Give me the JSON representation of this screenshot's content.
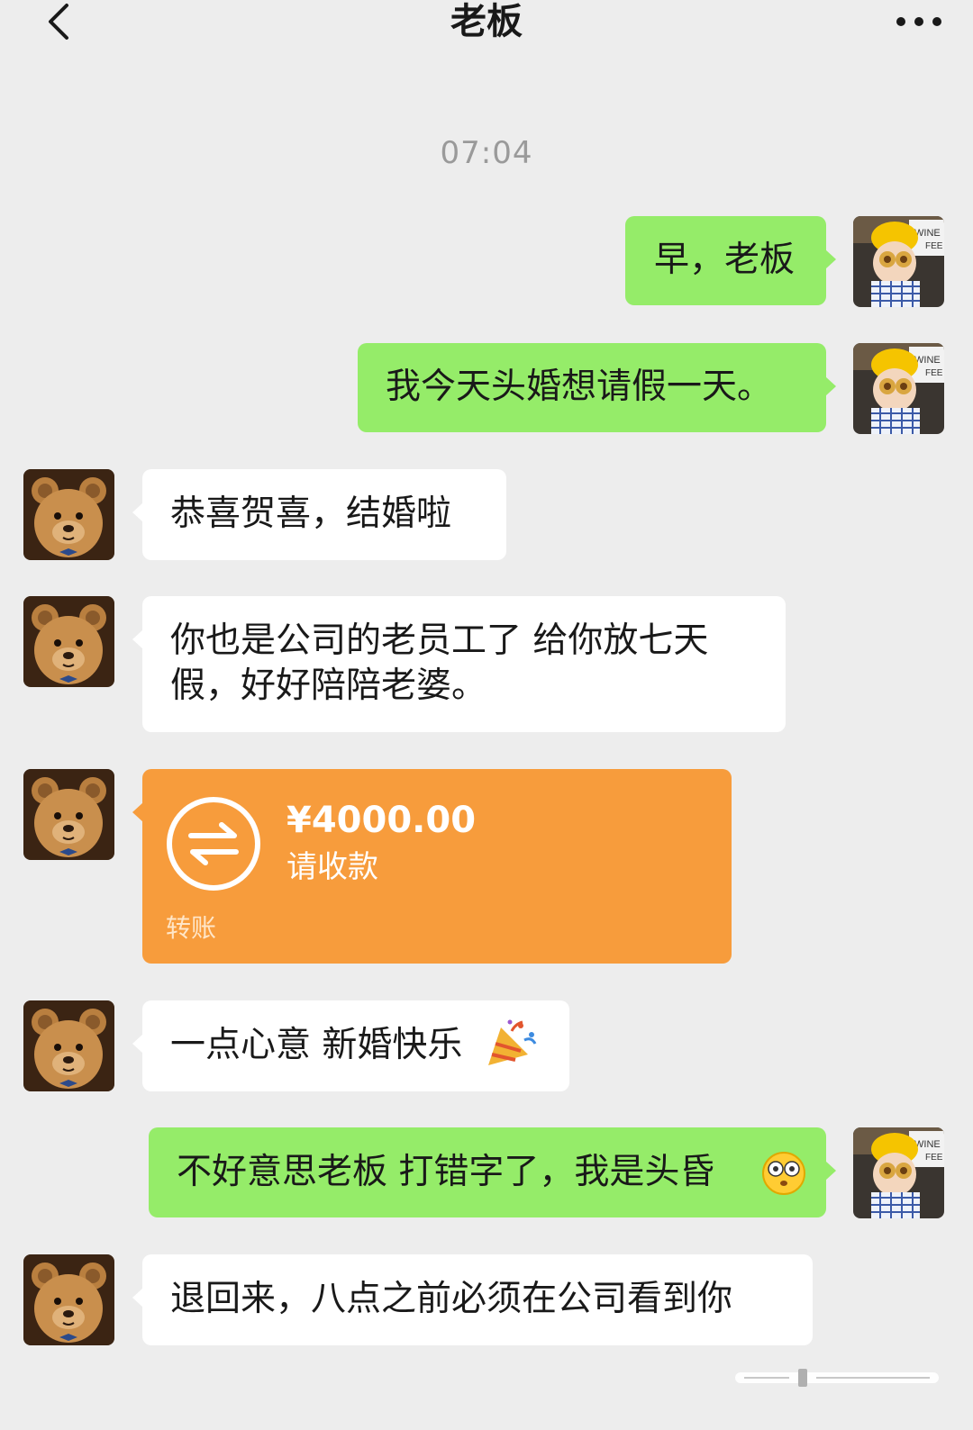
{
  "header": {
    "title": "老板",
    "back_icon": "chevron-left-icon",
    "more_icon": "more-horizontal-icon"
  },
  "timestamp": "07:04",
  "colors": {
    "background": "#ededed",
    "my_bubble": "#95ec69",
    "their_bubble": "#ffffff",
    "transfer_card": "#f79c3c",
    "timestamp_text": "#9a9a9a"
  },
  "messages": [
    {
      "sender": "me",
      "text": "早，老板"
    },
    {
      "sender": "me",
      "text": "我今天头婚想请假一天。"
    },
    {
      "sender": "boss",
      "text": "恭喜贺喜，结婚啦"
    },
    {
      "sender": "boss",
      "text": "你也是公司的老员工了 给你放七天假，好好陪陪老婆。"
    },
    {
      "sender": "boss",
      "type": "transfer",
      "amount": "¥4000.00",
      "status": "请收款",
      "label": "转账",
      "icon": "transfer-arrows-icon"
    },
    {
      "sender": "boss",
      "text": "一点心意 新婚快乐",
      "emoji": "party-popper-icon"
    },
    {
      "sender": "me",
      "text": "不好意思老板 打错字了，我是头昏",
      "emoji": "flushed-face-icon"
    },
    {
      "sender": "boss",
      "text": "退回来，八点之前必须在公司看到你"
    }
  ],
  "avatars": {
    "me": "child-with-hard-hat-avatar",
    "boss": "teddy-bear-avatar",
    "me_avatar_sign_text": "WINE"
  }
}
